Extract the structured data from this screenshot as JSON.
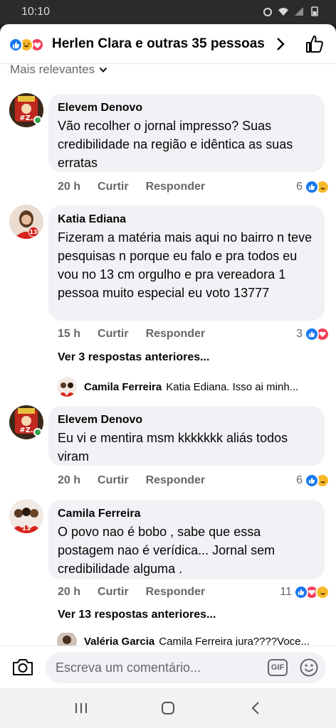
{
  "status_bar": {
    "time": "10:10"
  },
  "header": {
    "title": "Herlen Clara e outras 35 pessoas"
  },
  "sort": {
    "label": "Mais relevantes"
  },
  "comments": [
    {
      "name": "Elevem Denovo",
      "text": "Vão recolher o jornal impresso? Suas credibilidade na região e idêntica as suas erratas",
      "time": "20 h",
      "like_label": "Curtir",
      "reply_label": "Responder",
      "reaction_count": "6"
    },
    {
      "name": "Katia Ediana",
      "text": "Fizeram a matéria mais aqui no bairro n teve pesquisas  n porque eu falo e pra todos eu vou no 13 cm orgulho e pra vereadora 1 pessoa muito especial eu voto 13777",
      "time": "15 h",
      "like_label": "Curtir",
      "reply_label": "Responder",
      "reaction_count": "3"
    },
    {
      "name": "Elevem Denovo",
      "text": "Eu vi e mentira msm kkkkkkk aliás todos viram",
      "time": "20 h",
      "like_label": "Curtir",
      "reply_label": "Responder",
      "reaction_count": "6"
    },
    {
      "name": "Camila Ferreira",
      "text": "O povo nao é bobo , sabe que essa postagem nao é verídica...  Jornal sem credibilidade alguma .",
      "time": "20 h",
      "like_label": "Curtir",
      "reply_label": "Responder",
      "reaction_count": "11"
    }
  ],
  "thread_1": {
    "more_replies": "Ver 3 respostas anteriores...",
    "reply_name": "Camila Ferreira",
    "reply_text": "Katia Ediana.  Isso ai minh..."
  },
  "thread_2": {
    "more_replies": "Ver 13 respostas anteriores...",
    "reply_name": "Valéria Garcia",
    "reply_text": "Camila Ferreira jura????Voce..."
  },
  "composer": {
    "placeholder": "Escreva um comentário...",
    "gif_label": "GIF"
  },
  "colors": {
    "like": "#1877f2",
    "love": "#f33e58",
    "haha": "#f7b928",
    "bubble": "#f0f2f5",
    "meta": "#65676b"
  },
  "icons": [
    "like-reaction-icon",
    "haha-reaction-icon",
    "love-reaction-icon",
    "chevron-right-icon",
    "thumbs-up-icon",
    "chevron-down-icon",
    "camera-icon",
    "gif-icon",
    "emoji-icon",
    "recents-icon",
    "home-icon",
    "back-icon"
  ]
}
